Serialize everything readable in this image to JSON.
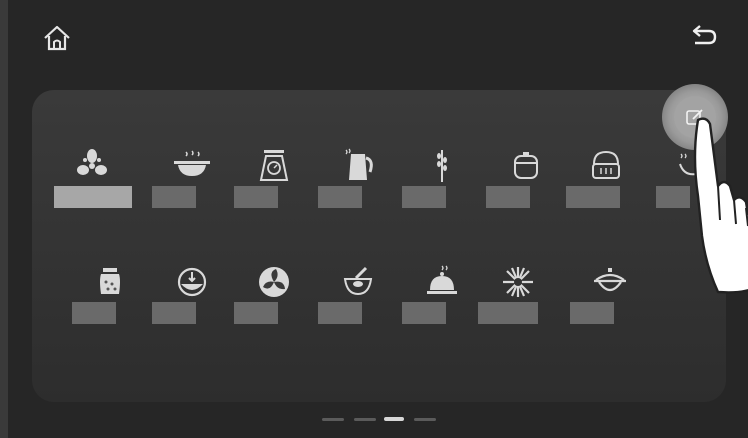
{
  "topbar": {
    "home_icon": "home-icon",
    "back_icon": "back-arrow-icon"
  },
  "colors": {
    "background": "#262626",
    "panel": "#343434",
    "icon": "#d9d9d9",
    "label_placeholder": "#6a6a6a",
    "label_selected": "#a7a7a7",
    "edit_button": "#a3a3a3"
  },
  "grid": {
    "row1": [
      {
        "name": "fan-icon",
        "selected": true
      },
      {
        "name": "steaming-pan-icon",
        "selected": false
      },
      {
        "name": "kitchen-scale-icon",
        "selected": false
      },
      {
        "name": "kettle-icon",
        "selected": false
      },
      {
        "name": "wheat-icon",
        "selected": false
      },
      {
        "name": "rice-cooker-icon",
        "selected": false
      },
      {
        "name": "basket-icon",
        "selected": false
      },
      {
        "name": "wok-icon",
        "selected": false
      }
    ],
    "row2": [
      {
        "name": "jar-icon",
        "selected": false
      },
      {
        "name": "timer-dial-icon",
        "selected": false
      },
      {
        "name": "turbine-icon",
        "selected": false
      },
      {
        "name": "mortar-icon",
        "selected": false
      },
      {
        "name": "cloche-icon",
        "selected": false
      },
      {
        "name": "sunburst-icon",
        "selected": false
      },
      {
        "name": "pot-lid-icon",
        "selected": false
      }
    ]
  },
  "pagination": {
    "total": 4,
    "active": 3
  },
  "edit_button": {
    "icon": "edit-icon"
  }
}
